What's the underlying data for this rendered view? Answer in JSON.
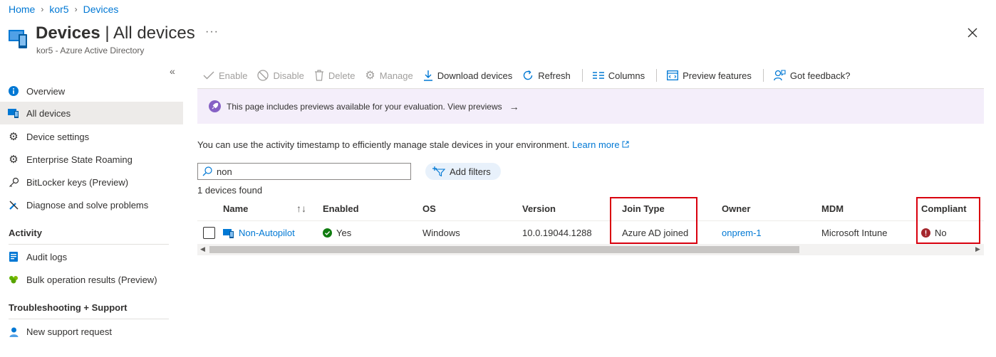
{
  "breadcrumb": {
    "items": [
      "Home",
      "kor5",
      "Devices"
    ]
  },
  "header": {
    "title_bold": "Devices",
    "title_rest": " | All devices",
    "subtitle": "kor5 - Azure Active Directory",
    "more": "···"
  },
  "sidebar": {
    "collapse": "«",
    "items": [
      {
        "label": "Overview",
        "icon": "info-icon"
      },
      {
        "label": "All devices",
        "icon": "device-icon",
        "active": true
      },
      {
        "label": "Device settings",
        "icon": "gear-icon"
      },
      {
        "label": "Enterprise State Roaming",
        "icon": "gear-icon"
      },
      {
        "label": "BitLocker keys (Preview)",
        "icon": "key-icon"
      },
      {
        "label": "Diagnose and solve problems",
        "icon": "wrench-icon"
      }
    ],
    "section_activity": "Activity",
    "activity_items": [
      {
        "label": "Audit logs",
        "icon": "log-icon"
      },
      {
        "label": "Bulk operation results (Preview)",
        "icon": "people-icon"
      }
    ],
    "section_support": "Troubleshooting + Support",
    "support_items": [
      {
        "label": "New support request",
        "icon": "support-person-icon"
      }
    ]
  },
  "toolbar": {
    "enable": "Enable",
    "disable": "Disable",
    "delete": "Delete",
    "manage": "Manage",
    "download": "Download devices",
    "refresh": "Refresh",
    "columns": "Columns",
    "preview": "Preview features",
    "feedback": "Got feedback?"
  },
  "banner": {
    "text": "This page includes previews available for your evaluation. View previews",
    "arrow": "→"
  },
  "info": {
    "text": "You can use the activity timestamp to efficiently manage stale devices in your environment.",
    "link": "Learn more"
  },
  "search": {
    "value": "non",
    "placeholder": ""
  },
  "filters": {
    "add_label": "Add filters"
  },
  "results": {
    "count_text": "1 devices found"
  },
  "table": {
    "headers": [
      "Name",
      "Enabled",
      "OS",
      "Version",
      "Join Type",
      "Owner",
      "MDM",
      "Compliant"
    ],
    "rows": [
      {
        "name": "Non-Autopilot",
        "enabled": "Yes",
        "os": "Windows",
        "version": "10.0.19044.1288",
        "join_type": "Azure AD joined",
        "owner": "onprem-1",
        "mdm": "Microsoft Intune",
        "compliant": "No"
      }
    ]
  },
  "colors": {
    "accent": "#0078d4",
    "highlight": "#d9000e",
    "success": "#107c10",
    "error": "#a4262c",
    "preview_purple": "#8661c5"
  }
}
